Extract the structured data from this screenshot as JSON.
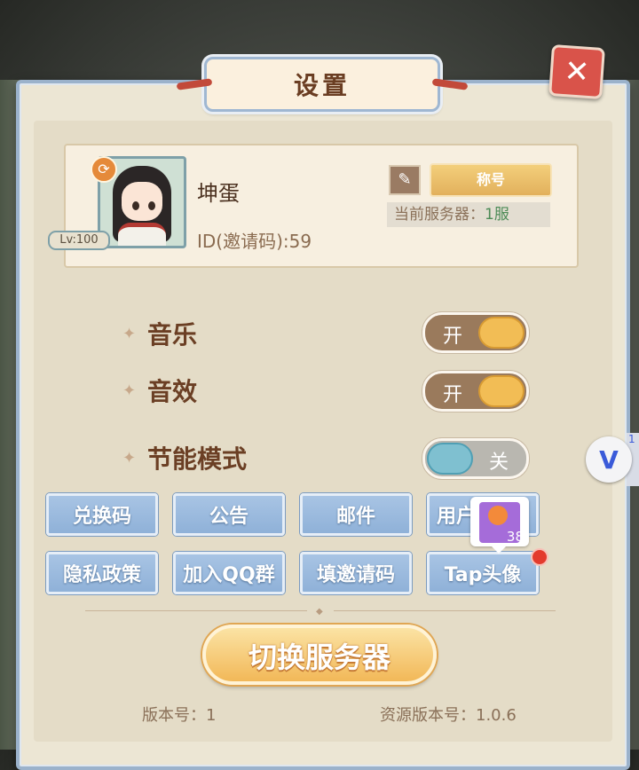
{
  "dialog": {
    "title": "设置",
    "close_glyph": "✕"
  },
  "profile": {
    "nickname": "坤蛋",
    "id_line": "ID(邀请码):59",
    "level": "Lv:100",
    "title_button": "称号",
    "server_label": "当前服务器：",
    "server_value": "1服",
    "edit_icon": "pencil-icon",
    "sync_icon": "refresh-icon"
  },
  "settings": [
    {
      "label": "音乐",
      "state": "开",
      "on": true
    },
    {
      "label": "音效",
      "state": "开",
      "on": true
    },
    {
      "label": "节能模式",
      "state": "关",
      "on": false
    }
  ],
  "buttons_row1": [
    "兑换码",
    "公告",
    "邮件",
    "用户"
  ],
  "buttons_row2": [
    "隐私政策",
    "加入QQ群",
    "填邀请码",
    "Tap头像"
  ],
  "item_popup": {
    "count": "38"
  },
  "switch_server": "切换服务器",
  "footer": {
    "version": "版本号：1",
    "resource_version": "资源版本号：1.0.6"
  },
  "floating": {
    "letter": "V",
    "badge": "1"
  },
  "colors": {
    "accent_blue": "#9bb2cb",
    "toggle_on": "#f2bd55",
    "toggle_off": "#7fc0d0",
    "close_red": "#d9534a"
  }
}
